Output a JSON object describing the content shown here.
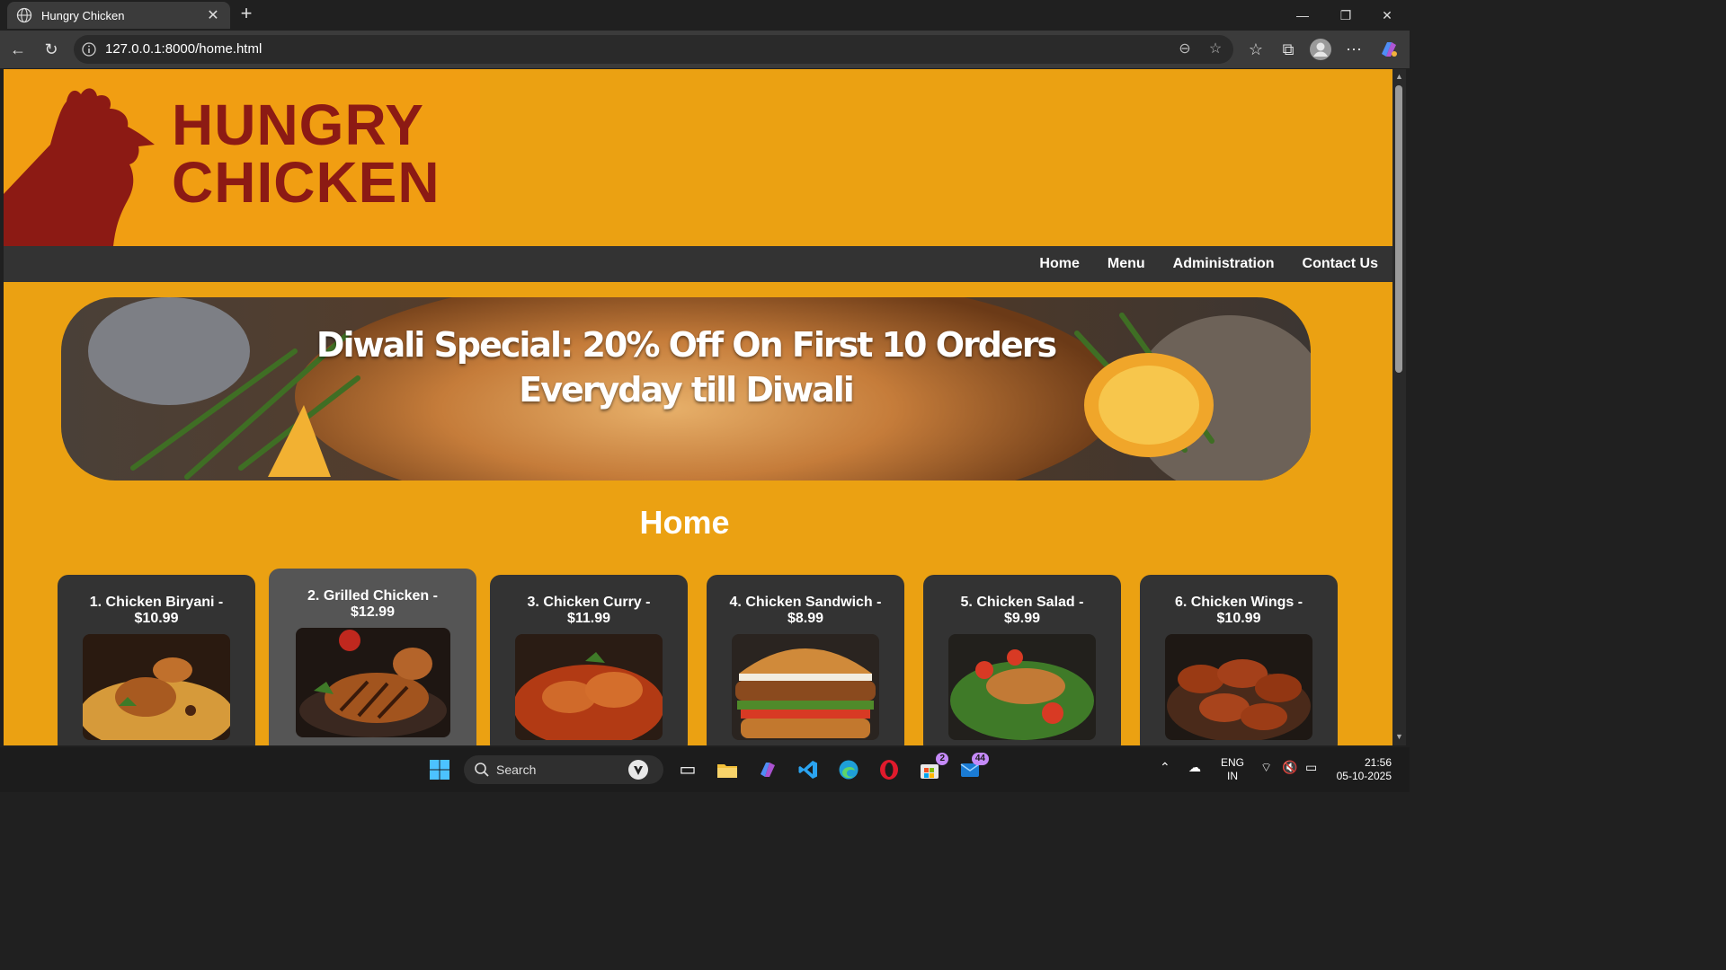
{
  "browser": {
    "tab_title": "Hungry Chicken",
    "url": "127.0.0.1:8000/home.html"
  },
  "site": {
    "logo_line1": "HUNGRY",
    "logo_line2": "CHICKEN",
    "nav": [
      "Home",
      "Menu",
      "Administration",
      "Contact Us"
    ],
    "banner_line1": "Diwali Special: 20% Off On First 10 Orders",
    "banner_line2": "Everyday till Diwali",
    "page_title": "Home",
    "cards": [
      {
        "name": "1. Chicken Biryani -",
        "price": "$10.99",
        "photo": "biryani-photo"
      },
      {
        "name": "2. Grilled Chicken -",
        "price": "$12.99",
        "photo": "grilled-chicken-photo"
      },
      {
        "name": "3. Chicken Curry -",
        "price": "$11.99",
        "photo": "curry-photo"
      },
      {
        "name": "4. Chicken Sandwich -",
        "price": "$8.99",
        "photo": "sandwich-photo"
      },
      {
        "name": "5. Chicken Salad -",
        "price": "$9.99",
        "photo": "salad-photo"
      },
      {
        "name": "6. Chicken Wings -",
        "price": "$10.99",
        "photo": "wings-photo"
      }
    ],
    "colors": {
      "page_bg": "#eba112",
      "logo_red": "#8c1a14",
      "nav_bg": "#333333",
      "card_bg": "#333333"
    }
  },
  "taskbar": {
    "search_label": "Search",
    "store_badge": "2",
    "mail_badge": "44",
    "lang_line1": "ENG",
    "lang_line2": "IN",
    "time": "21:56",
    "date": "05-10-2025"
  }
}
